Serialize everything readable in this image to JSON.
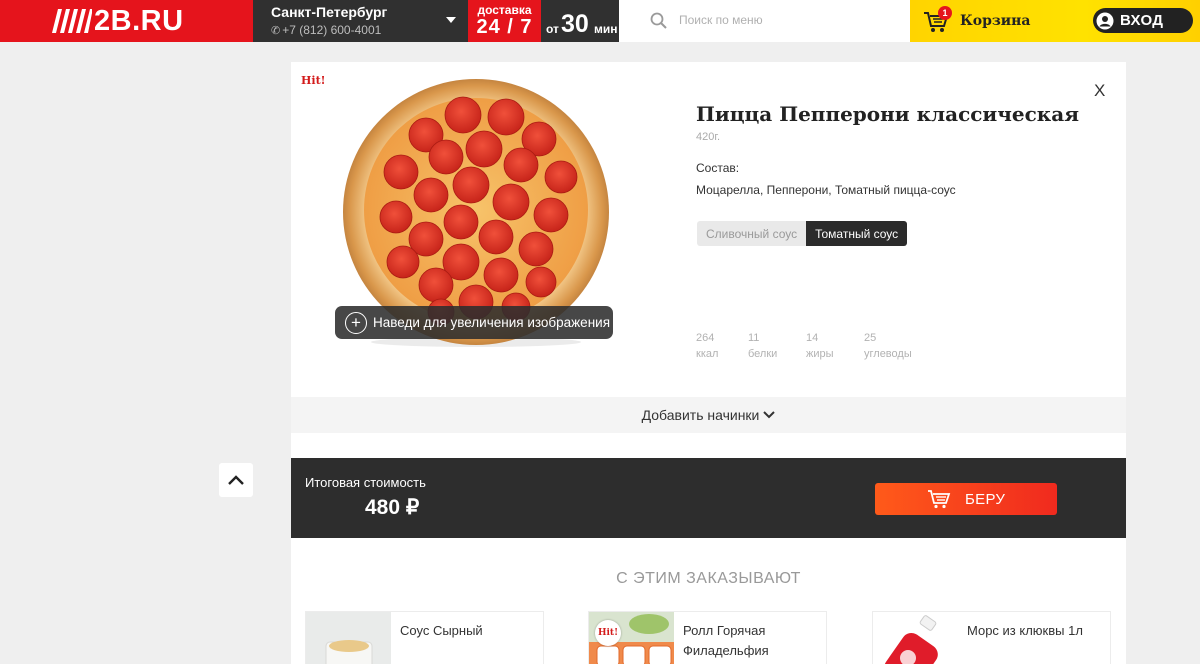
{
  "header": {
    "logo_text": "2B.RU",
    "city": "Санкт-Петербург",
    "phone": "+7 (812) 600-4001",
    "delivery_label": "доставка",
    "delivery_hours": "24 / 7",
    "delivery_prefix": "от",
    "delivery_minutes": "30",
    "delivery_unit": "мин",
    "search_placeholder": "Поиск по меню",
    "cart_label": "Корзина",
    "cart_count": "1",
    "login_label": "ВХОД"
  },
  "product": {
    "hit_badge": "Hit!",
    "title": "Пицца Пепперони классическая",
    "weight": "420г.",
    "composition_label": "Состав:",
    "composition": "Моцарелла, Пепперони, Томатный пицца-соус",
    "sauces": [
      {
        "label": "Сливочный соус",
        "active": false
      },
      {
        "label": "Томатный соус",
        "active": true
      }
    ],
    "zoom_hint": "Наведи для увеличения изображения",
    "close_label": "X",
    "nutrition": [
      {
        "value": "264",
        "unit": "ккал"
      },
      {
        "value": "11",
        "unit": "белки"
      },
      {
        "value": "14",
        "unit": "жиры"
      },
      {
        "value": "25",
        "unit": "углеводы"
      }
    ]
  },
  "toppings": {
    "label": "Добавить начинки"
  },
  "total": {
    "label": "Итоговая стоимость",
    "price": "480 ₽",
    "buy_label": "БЕРУ"
  },
  "related": {
    "title": "С ЭТИМ ЗАКАЗЫВАЮТ",
    "items": [
      {
        "name": "Соус Сырный"
      },
      {
        "name": "Ролл Горячая Филадельфия",
        "hit": "Hit!"
      },
      {
        "name": "Морс из клюквы 1л"
      }
    ]
  },
  "colors": {
    "brand_red": "#e5141c",
    "cart_yellow": "#ffd400",
    "dark": "#2d2d2d",
    "buy_orange": "#ff5a1a"
  }
}
